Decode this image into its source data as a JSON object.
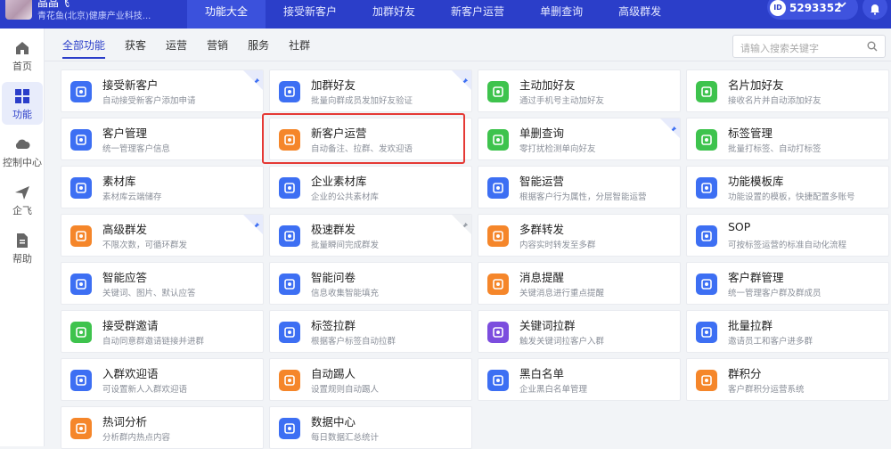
{
  "header": {
    "user_name": "晶晶飞",
    "company": "青花鱼(北京)健康产业科技...",
    "tabs": [
      "功能大全",
      "接受新客户",
      "加群好友",
      "新客户运营",
      "单删查询",
      "高级群发"
    ],
    "active_tab": 0,
    "id_badge": "ID",
    "account_id": "5293352"
  },
  "sidebar": {
    "items": [
      {
        "label": "首页",
        "icon": "home-icon"
      },
      {
        "label": "功能",
        "icon": "grid-icon"
      },
      {
        "label": "控制中心",
        "icon": "cloud-icon"
      },
      {
        "label": "企飞",
        "icon": "plane-icon"
      },
      {
        "label": "帮助",
        "icon": "doc-icon"
      }
    ],
    "active": 1
  },
  "subtabs": [
    "全部功能",
    "获客",
    "运营",
    "营销",
    "服务",
    "社群"
  ],
  "search": {
    "placeholder": "请输入搜索关键字"
  },
  "colors": {
    "brand": "#2b3ec9",
    "blue": "#3d6ff3",
    "green": "#3ec34d",
    "orange": "#f5862a",
    "red": "#e53935"
  },
  "cards": [
    {
      "title": "接受新客户",
      "desc": "自动接受新客户添加申请",
      "color": "#3d6ff3",
      "icon": "user-check-icon",
      "pinned": true
    },
    {
      "title": "加群好友",
      "desc": "批量向群成员发加好友验证",
      "color": "#3d6ff3",
      "icon": "user-add-icon",
      "pinned": true
    },
    {
      "title": "主动加好友",
      "desc": "通过手机号主动加好友",
      "color": "#3ec34d",
      "icon": "user-plus-icon",
      "pinned": false
    },
    {
      "title": "名片加好友",
      "desc": "接收名片并自动添加好友",
      "color": "#3ec34d",
      "icon": "card-icon",
      "pinned": false
    },
    {
      "title": "客户管理",
      "desc": "统一管理客户信息",
      "color": "#3d6ff3",
      "icon": "contact-icon",
      "pinned": false
    },
    {
      "title": "新客户运营",
      "desc": "自动备注、拉群、发欢迎语",
      "color": "#f5862a",
      "icon": "new-user-icon",
      "pinned": false
    },
    {
      "title": "单删查询",
      "desc": "零打扰检测单向好友",
      "color": "#3ec34d",
      "icon": "shield-icon",
      "pinned": true
    },
    {
      "title": "标签管理",
      "desc": "批量打标签、自动打标签",
      "color": "#3ec34d",
      "icon": "tag-card-icon",
      "pinned": false
    },
    {
      "title": "素材库",
      "desc": "素材库云端储存",
      "color": "#3d6ff3",
      "icon": "box-icon",
      "pinned": false
    },
    {
      "title": "企业素材库",
      "desc": "企业的公共素材库",
      "color": "#3d6ff3",
      "icon": "folder-icon",
      "pinned": false
    },
    {
      "title": "智能运营",
      "desc": "根据客户行为属性，分层智能运营",
      "color": "#3d6ff3",
      "icon": "smart-icon",
      "pinned": false
    },
    {
      "title": "功能模板库",
      "desc": "功能设置的模板，快捷配置多账号",
      "color": "#3d6ff3",
      "icon": "template-icon",
      "pinned": false
    },
    {
      "title": "高级群发",
      "desc": "不限次数，可循环群发",
      "color": "#f5862a",
      "icon": "send-icon",
      "pinned": true
    },
    {
      "title": "极速群发",
      "desc": "批量瞬间完成群发",
      "color": "#3d6ff3",
      "icon": "flash-icon",
      "pinned": true,
      "pin_grey": true
    },
    {
      "title": "多群转发",
      "desc": "内容实时转发至多群",
      "color": "#f5862a",
      "icon": "video-icon",
      "pinned": false
    },
    {
      "title": "SOP",
      "desc": "可按标签运营的标准自动化流程",
      "color": "#3d6ff3",
      "icon": "sop-icon",
      "pinned": false
    },
    {
      "title": "智能应答",
      "desc": "关键词、图片、默认应答",
      "color": "#3d6ff3",
      "icon": "robot-icon",
      "pinned": false
    },
    {
      "title": "智能问卷",
      "desc": "信息收集智能填充",
      "color": "#3d6ff3",
      "icon": "form-icon",
      "pinned": false
    },
    {
      "title": "消息提醒",
      "desc": "关键消息进行重点提醒",
      "color": "#f5862a",
      "icon": "bell-icon",
      "pinned": false
    },
    {
      "title": "客户群管理",
      "desc": "统一管理客户群及群成员",
      "color": "#3d6ff3",
      "icon": "group-icon",
      "pinned": false
    },
    {
      "title": "接受群邀请",
      "desc": "自动同意群邀请链接并进群",
      "color": "#3ec34d",
      "icon": "mail-icon",
      "pinned": false
    },
    {
      "title": "标签拉群",
      "desc": "根据客户标签自动拉群",
      "color": "#3d6ff3",
      "icon": "tag-icon",
      "pinned": false
    },
    {
      "title": "关键词拉群",
      "desc": "触发关键词拉客户入群",
      "color": "#7c4dde",
      "icon": "keyword-icon",
      "pinned": false
    },
    {
      "title": "批量拉群",
      "desc": "邀请员工和客户进多群",
      "color": "#3d6ff3",
      "icon": "batch-add-icon",
      "pinned": false
    },
    {
      "title": "入群欢迎语",
      "desc": "可设置新人入群欢迎语",
      "color": "#3d6ff3",
      "icon": "hi-icon",
      "pinned": false
    },
    {
      "title": "自动踢人",
      "desc": "设置规则自动踢人",
      "color": "#f5862a",
      "icon": "kick-icon",
      "pinned": false
    },
    {
      "title": "黑白名单",
      "desc": "企业黑白名单管理",
      "color": "#3d6ff3",
      "icon": "list-icon",
      "pinned": false
    },
    {
      "title": "群积分",
      "desc": "客户群积分运营系统",
      "color": "#f5862a",
      "icon": "star-icon",
      "pinned": false
    },
    {
      "title": "热词分析",
      "desc": "分析群内热点内容",
      "color": "#f5862a",
      "icon": "hot-icon",
      "pinned": false
    },
    {
      "title": "数据中心",
      "desc": "每日数据汇总统计",
      "color": "#3d6ff3",
      "icon": "pie-icon",
      "pinned": false
    }
  ],
  "highlighted_card": "新客户运营"
}
